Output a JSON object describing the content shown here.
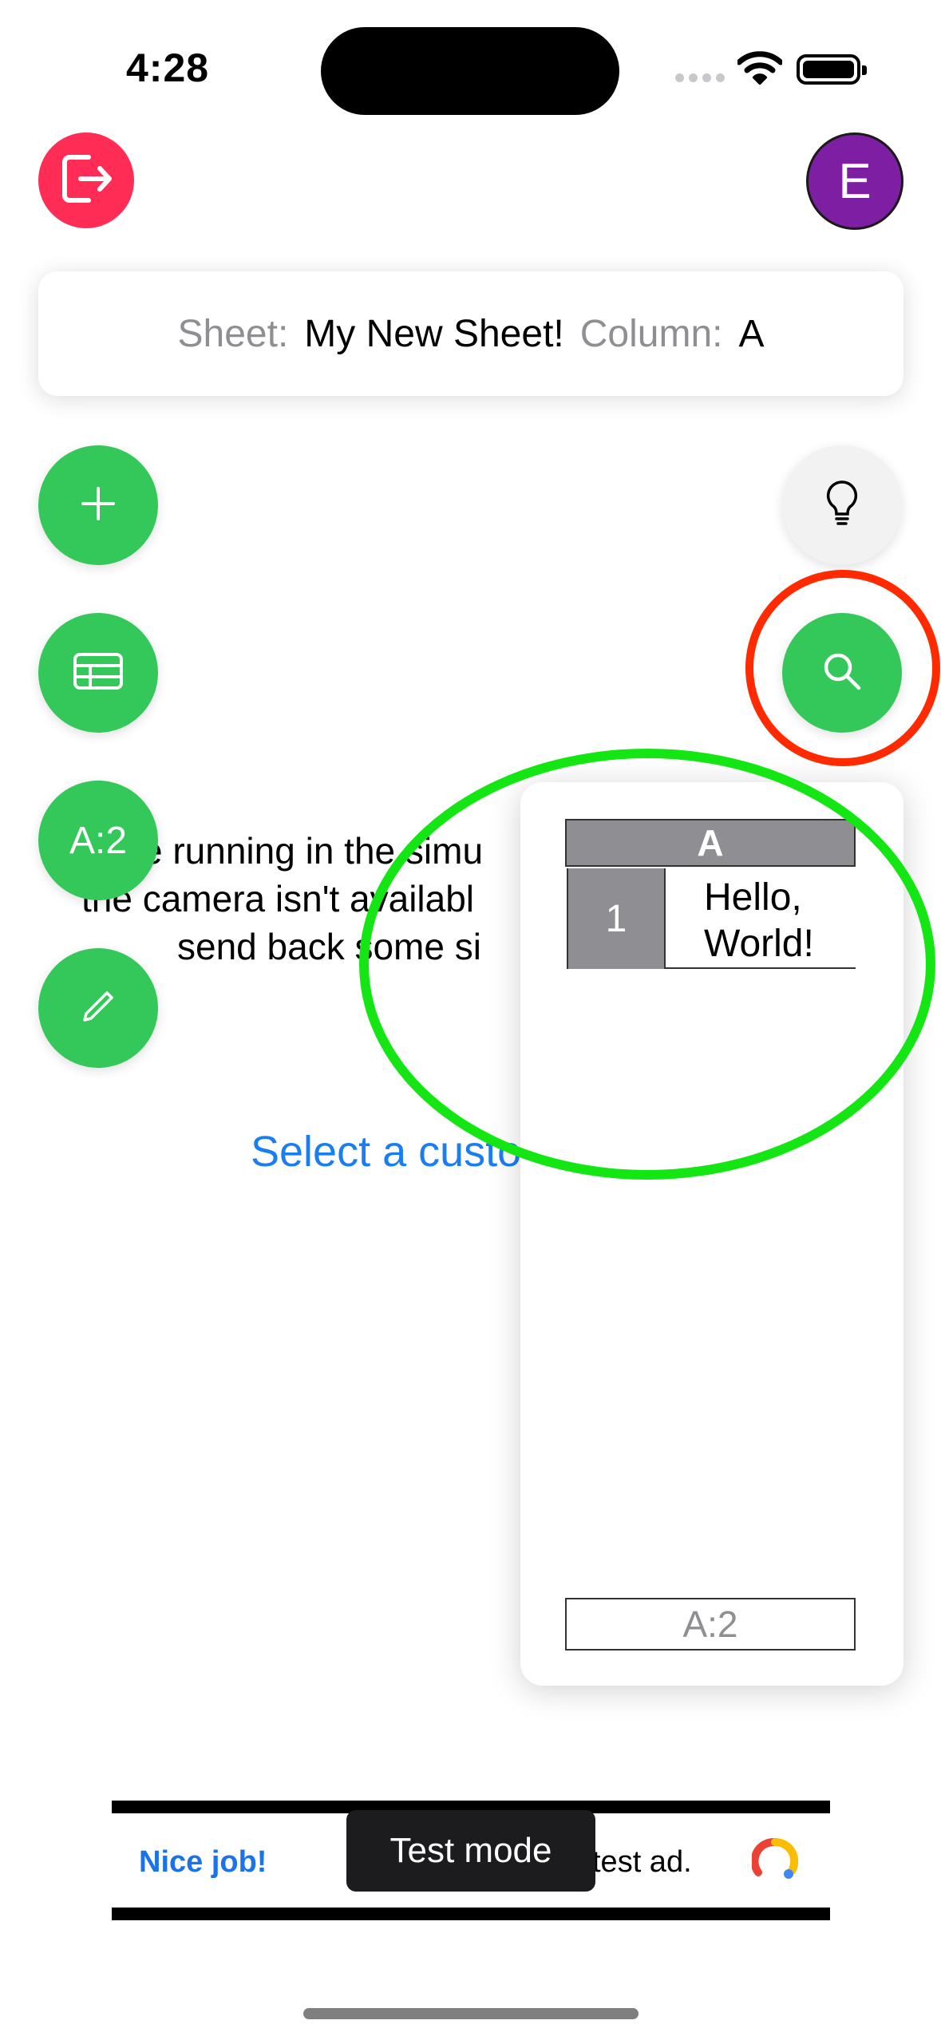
{
  "status_bar": {
    "time": "4:28"
  },
  "top": {
    "avatar_initial": "E"
  },
  "info_card": {
    "sheet_label": "Sheet:",
    "sheet_value": "My New Sheet!",
    "column_label": "Column:",
    "column_value": "A"
  },
  "background": {
    "simulator_line1": "e running in the simu",
    "simulator_line2": "the camera isn't availabl",
    "simulator_line3": "send back some si",
    "select_link": "Select a custo"
  },
  "fabs": {
    "cell_label": "A:2"
  },
  "panel": {
    "column_header": "A",
    "row_number": "1",
    "cell_value": "Hello, World!",
    "cell_ref": "A:2"
  },
  "ad": {
    "left_text": "Nice job!",
    "right_text": "test ad.",
    "test_mode": "Test mode"
  },
  "colors": {
    "logout": "#ff2d55",
    "avatar": "#7e1fa3",
    "fab_green": "#34c759",
    "link_blue": "#1a7ef2",
    "annotation_red": "#ff2a00",
    "annotation_green": "#14e614"
  },
  "icons": [
    "logout-icon",
    "plus-icon",
    "table-icon",
    "pencil-icon",
    "lightbulb-icon",
    "search-icon",
    "wifi-icon",
    "battery-icon",
    "ad-logo-icon"
  ]
}
